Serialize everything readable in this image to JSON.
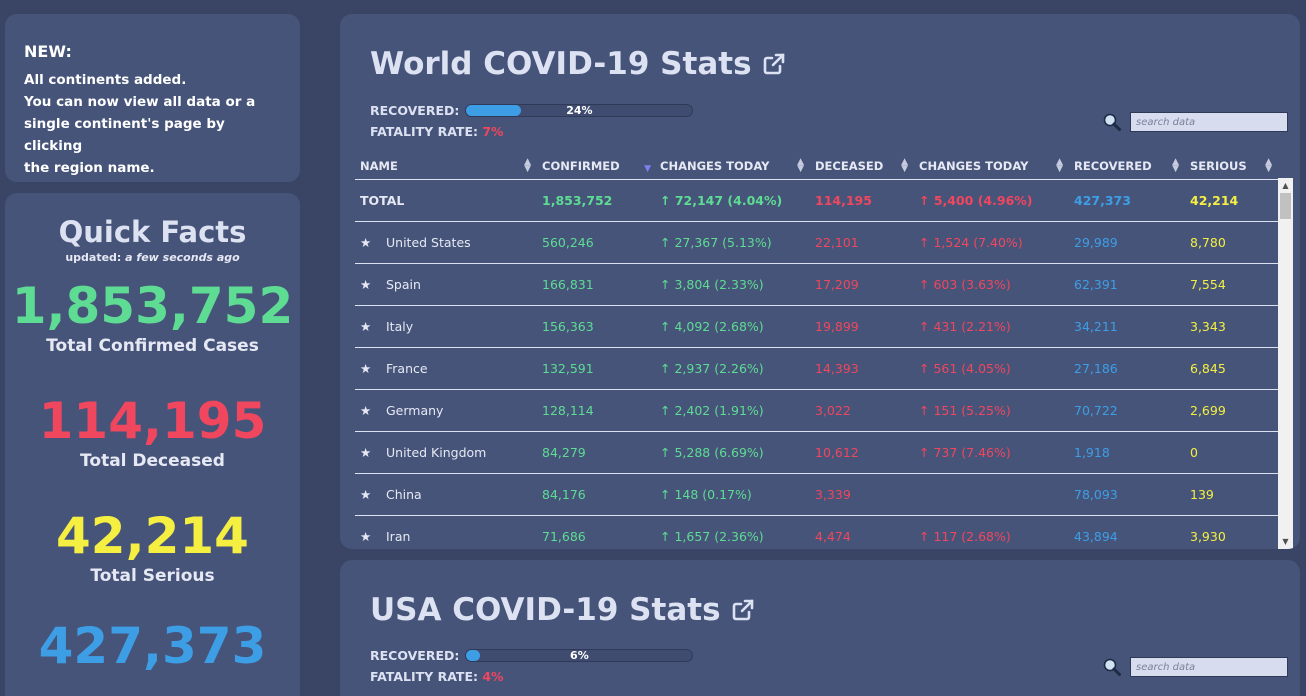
{
  "news": {
    "title": "NEW:",
    "lines": [
      "All continents added.",
      "You can now view all data or a",
      "single continent's page by clicking",
      "the region name."
    ]
  },
  "facts": {
    "title": "Quick Facts",
    "updated_prefix": "updated:",
    "updated_value": "a few seconds ago",
    "confirmed": "1,853,752",
    "confirmed_label": "Total Confirmed Cases",
    "deceased": "114,195",
    "deceased_label": "Total Deceased",
    "serious": "42,214",
    "serious_label": "Total Serious",
    "recovered": "427,373"
  },
  "world": {
    "title": "World COVID-19 Stats",
    "recovered_label": "RECOVERED:",
    "recovered_pct_text": "24%",
    "recovered_fraction": 0.24,
    "fatality_label": "FATALITY RATE:",
    "fatality_value": "7%",
    "search_placeholder": "search data",
    "columns": [
      "NAME",
      "CONFIRMED",
      "CHANGES TODAY",
      "DECEASED",
      "CHANGES TODAY",
      "RECOVERED",
      "SERIOUS"
    ],
    "total": {
      "name": "TOTAL",
      "confirmed": "1,853,752",
      "change": "↑ 72,147 (4.04%)",
      "deceased": "114,195",
      "change_deceased": "↑ 5,400 (4.96%)",
      "recovered": "427,373",
      "serious": "42,214"
    },
    "rows": [
      {
        "name": "United States",
        "confirmed": "560,246",
        "change": "↑ 27,367 (5.13%)",
        "deceased": "22,101",
        "change_deceased": "↑ 1,524 (7.40%)",
        "recovered": "29,989",
        "serious": "8,780"
      },
      {
        "name": "Spain",
        "confirmed": "166,831",
        "change": "↑ 3,804 (2.33%)",
        "deceased": "17,209",
        "change_deceased": "↑ 603 (3.63%)",
        "recovered": "62,391",
        "serious": "7,554"
      },
      {
        "name": "Italy",
        "confirmed": "156,363",
        "change": "↑ 4,092 (2.68%)",
        "deceased": "19,899",
        "change_deceased": "↑ 431 (2.21%)",
        "recovered": "34,211",
        "serious": "3,343"
      },
      {
        "name": "France",
        "confirmed": "132,591",
        "change": "↑ 2,937 (2.26%)",
        "deceased": "14,393",
        "change_deceased": "↑ 561 (4.05%)",
        "recovered": "27,186",
        "serious": "6,845"
      },
      {
        "name": "Germany",
        "confirmed": "128,114",
        "change": "↑ 2,402 (1.91%)",
        "deceased": "3,022",
        "change_deceased": "↑ 151 (5.25%)",
        "recovered": "70,722",
        "serious": "2,699"
      },
      {
        "name": "United Kingdom",
        "confirmed": "84,279",
        "change": "↑ 5,288 (6.69%)",
        "deceased": "10,612",
        "change_deceased": "↑ 737 (7.46%)",
        "recovered": "1,918",
        "serious": "0"
      },
      {
        "name": "China",
        "confirmed": "84,176",
        "change": "↑ 148 (0.17%)",
        "deceased": "3,339",
        "change_deceased": "",
        "recovered": "78,093",
        "serious": "139"
      },
      {
        "name": "Iran",
        "confirmed": "71,686",
        "change": "↑ 1,657 (2.36%)",
        "deceased": "4,474",
        "change_deceased": "↑ 117 (2.68%)",
        "recovered": "43,894",
        "serious": "3,930"
      }
    ]
  },
  "usa": {
    "title": "USA COVID-19 Stats",
    "recovered_label": "RECOVERED:",
    "recovered_pct_text": "6%",
    "recovered_fraction": 0.06,
    "fatality_label": "FATALITY RATE:",
    "fatality_value": "4%",
    "search_placeholder": "search data"
  },
  "colors": {
    "background": "#3a4566",
    "card": "#46547a",
    "confirmed": "#5edc93",
    "deceased": "#f0465e",
    "serious": "#f5ef42",
    "recovered": "#3d9ee6"
  },
  "icons": {
    "external_link": "external-link-icon",
    "search": "search-icon",
    "star": "star-icon",
    "sort": "sort-icon"
  }
}
